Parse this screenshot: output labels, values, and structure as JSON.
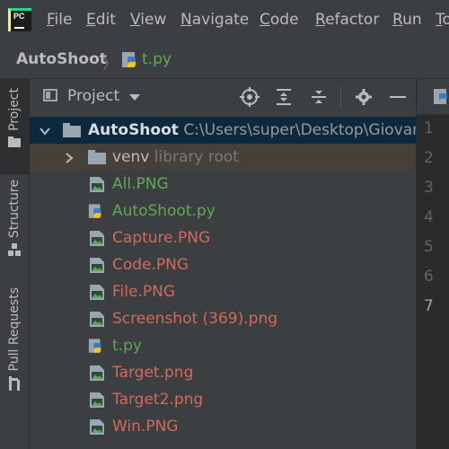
{
  "menubar": {
    "logo_text": "PC",
    "items": [
      "File",
      "Edit",
      "View",
      "Navigate",
      "Code",
      "Refactor",
      "Run",
      "To"
    ]
  },
  "navbar": {
    "project": "AutoShoot",
    "separator": "〉",
    "file": "t.py"
  },
  "tool_strip": {
    "tabs": [
      "Project",
      "Structure",
      "Pull Requests"
    ]
  },
  "project_panel": {
    "title": "Project",
    "root": {
      "name": "AutoShoot",
      "path": "C:\\Users\\super\\Desktop\\Giovanni"
    },
    "venv": {
      "name": "venv",
      "note": "library root"
    },
    "files": [
      {
        "name": "All.PNG",
        "type": "image",
        "color": "#62a851"
      },
      {
        "name": "AutoShoot.py",
        "type": "python",
        "color": "#62a851"
      },
      {
        "name": "Capture.PNG",
        "type": "image",
        "color": "#d2695c"
      },
      {
        "name": "Code.PNG",
        "type": "image",
        "color": "#d2695c"
      },
      {
        "name": "File.PNG",
        "type": "image",
        "color": "#d2695c"
      },
      {
        "name": "Screenshot (369).png",
        "type": "image",
        "color": "#d2695c"
      },
      {
        "name": "t.py",
        "type": "python",
        "color": "#62a851"
      },
      {
        "name": "Target.png",
        "type": "image",
        "color": "#d2695c"
      },
      {
        "name": "Target2.png",
        "type": "image",
        "color": "#d2695c"
      },
      {
        "name": "Win.PNG",
        "type": "image",
        "color": "#d2695c"
      }
    ]
  },
  "editor": {
    "line_numbers": [
      "1",
      "2",
      "3",
      "4",
      "5",
      "6",
      "7"
    ],
    "current_line": "7"
  },
  "colors": {
    "selection": "#0d293e",
    "excluded_bg": "#45403a",
    "added": "#62a851",
    "unversioned": "#d2695c"
  }
}
